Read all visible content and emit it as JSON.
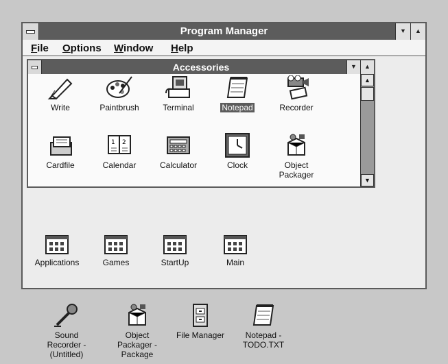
{
  "program_manager": {
    "title": "Program Manager",
    "minimize_glyph": "▼",
    "maximize_glyph": "▲",
    "menu": [
      "File",
      "Options",
      "Window",
      "Help"
    ]
  },
  "accessories": {
    "title": "Accessories",
    "minimize_glyph": "▼",
    "maximize_glyph": "▲",
    "scroll_up_glyph": "▲",
    "scroll_down_glyph": "▼",
    "icons": [
      {
        "label": "Write",
        "icon": "write-icon"
      },
      {
        "label": "Paintbrush",
        "icon": "paintbrush-icon"
      },
      {
        "label": "Terminal",
        "icon": "terminal-icon"
      },
      {
        "label": "Notepad",
        "icon": "notepad-icon",
        "selected": true
      },
      {
        "label": "Recorder",
        "icon": "recorder-icon"
      },
      {
        "label": "Cardfile",
        "icon": "cardfile-icon"
      },
      {
        "label": "Calendar",
        "icon": "calendar-icon"
      },
      {
        "label": "Calculator",
        "icon": "calculator-icon"
      },
      {
        "label": "Clock",
        "icon": "clock-icon"
      },
      {
        "label": "Object",
        "label_line2": "Packager",
        "icon": "object-packager-icon"
      }
    ]
  },
  "groups": [
    {
      "label": "Applications",
      "icon": "program-group-icon"
    },
    {
      "label": "Games",
      "icon": "program-group-icon"
    },
    {
      "label": "StartUp",
      "icon": "program-group-icon"
    },
    {
      "label": "Main",
      "icon": "program-group-icon"
    }
  ],
  "desktop_icons": [
    {
      "lines": [
        "Sound",
        "Recorder -",
        "(Untitled)"
      ],
      "icon": "sound-recorder-icon"
    },
    {
      "lines": [
        "Object",
        "Packager -",
        "Package"
      ],
      "icon": "object-packager-icon"
    },
    {
      "lines": [
        "File Manager"
      ],
      "icon": "file-manager-icon"
    },
    {
      "lines": [
        "Notepad -",
        "TODO.TXT"
      ],
      "icon": "notepad-icon"
    }
  ]
}
